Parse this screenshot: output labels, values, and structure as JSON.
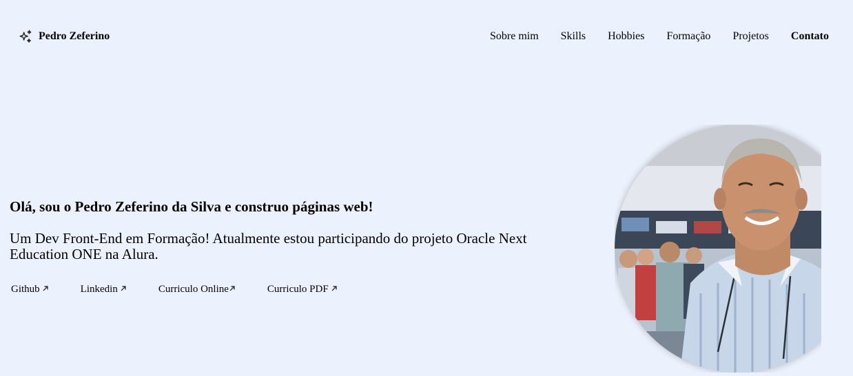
{
  "header": {
    "brand_icon": "sparkles-icon",
    "brand_name": "Pedro Zeferino",
    "nav": [
      {
        "label": "Sobre mim",
        "active": false
      },
      {
        "label": "Skills",
        "active": false
      },
      {
        "label": "Hobbies",
        "active": false
      },
      {
        "label": "Formação",
        "active": false
      },
      {
        "label": "Projetos",
        "active": false
      },
      {
        "label": "Contato",
        "active": true
      }
    ]
  },
  "hero": {
    "title": "Olá, sou o Pedro Zeferino da Silva e construo páginas web!",
    "subtitle": "Um Dev Front-End em Formação! Atualmente estou participando do projeto Oracle Next Education ONE na Alura.",
    "links": [
      {
        "label": "Github",
        "icon": "arrow-up-right-icon"
      },
      {
        "label": "Linkedin",
        "icon": "arrow-up-right-icon"
      },
      {
        "label": "Curriculo Online",
        "icon": "arrow-up-right-icon"
      },
      {
        "label": "Curriculo PDF",
        "icon": "arrow-up-right-icon"
      }
    ],
    "photo": "profile-photo"
  },
  "colors": {
    "background": "#ecf2fd",
    "text": "#000000"
  }
}
